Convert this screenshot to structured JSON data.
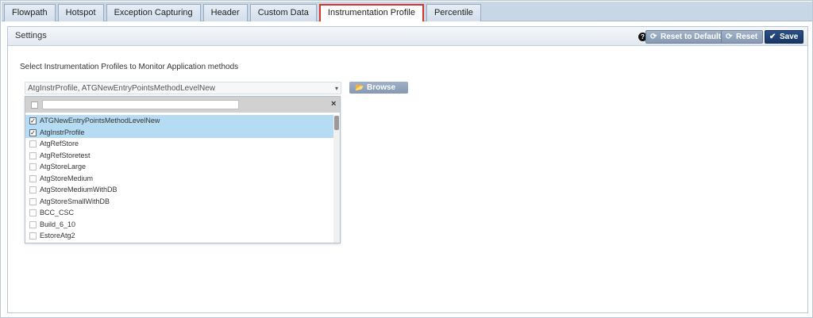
{
  "tabs": [
    {
      "label": "Flowpath",
      "active": false
    },
    {
      "label": "Hotspot",
      "active": false
    },
    {
      "label": "Exception Capturing",
      "active": false
    },
    {
      "label": "Header",
      "active": false
    },
    {
      "label": "Custom Data",
      "active": false
    },
    {
      "label": "Instrumentation Profile",
      "active": true
    },
    {
      "label": "Percentile",
      "active": false
    }
  ],
  "panel": {
    "title": "Settings",
    "help_icon": "?",
    "buttons": {
      "reset_default": {
        "label": "Reset to Default",
        "icon": "refresh-icon"
      },
      "reset": {
        "label": "Reset",
        "icon": "refresh-icon"
      },
      "save": {
        "label": "Save",
        "icon": "check-icon"
      }
    }
  },
  "instruction": "Select Instrumentation Profiles to Monitor Application methods",
  "selector": {
    "selected_text": "AtgInstrProfile, ATGNewEntryPointsMethodLevelNew",
    "caret": "▾",
    "browse_label": "Browse",
    "browse_icon": "folder-open-icon"
  },
  "dropdown": {
    "search_value": "",
    "close_glyph": "×",
    "items": [
      {
        "label": "ATGNewEntryPointsMethodLevelNew",
        "checked": true
      },
      {
        "label": "AtgInstrProfile",
        "checked": true
      },
      {
        "label": "AtgRefStore",
        "checked": false
      },
      {
        "label": "AtgRefStoretest",
        "checked": false
      },
      {
        "label": "AtgStoreLarge",
        "checked": false
      },
      {
        "label": "AtgStoreMedium",
        "checked": false
      },
      {
        "label": "AtgStoreMediumWithDB",
        "checked": false
      },
      {
        "label": "AtgStoreSmallWithDB",
        "checked": false
      },
      {
        "label": "BCC_CSC",
        "checked": false
      },
      {
        "label": "Build_6_10",
        "checked": false
      },
      {
        "label": "EstoreAtg2",
        "checked": false
      }
    ]
  },
  "colors": {
    "active_tab_border": "#d9332e",
    "save_button": "#1f4275",
    "checked_row": "#b5dcf2"
  }
}
